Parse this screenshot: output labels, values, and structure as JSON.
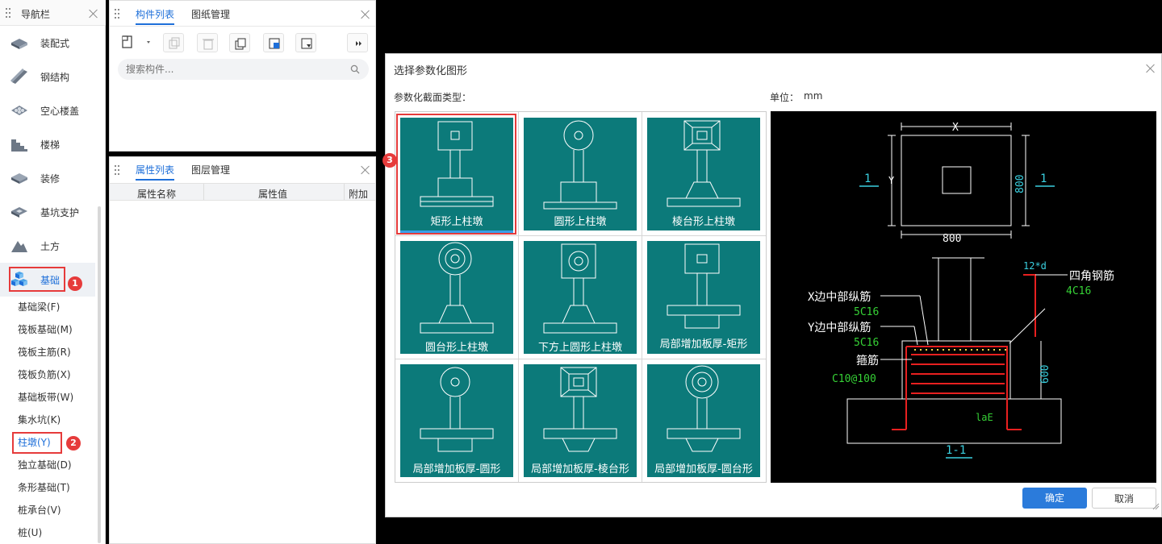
{
  "nav": {
    "title": "导航栏",
    "items": [
      {
        "label": "装配式",
        "icon": "prefab-icon"
      },
      {
        "label": "钢结构",
        "icon": "steel-beam-icon"
      },
      {
        "label": "空心楼盖",
        "icon": "hollow-slab-icon"
      },
      {
        "label": "楼梯",
        "icon": "stairs-icon"
      },
      {
        "label": "装修",
        "icon": "decoration-icon"
      },
      {
        "label": "基坑支护",
        "icon": "pit-support-icon"
      },
      {
        "label": "土方",
        "icon": "earthwork-icon"
      },
      {
        "label": "基础",
        "icon": "foundation-icon"
      }
    ],
    "sub_items": [
      "基础梁(F)",
      "筏板基础(M)",
      "筏板主筋(R)",
      "筏板负筋(X)",
      "基础板带(W)",
      "集水坑(K)",
      "柱墩(Y)",
      "独立基础(D)",
      "条形基础(T)",
      "桩承台(V)",
      "桩(U)"
    ],
    "badges": [
      "1",
      "2",
      "3"
    ]
  },
  "components": {
    "tabs": [
      "构件列表",
      "图纸管理"
    ],
    "search_placeholder": "搜索构件..."
  },
  "properties": {
    "tabs": [
      "属性列表",
      "图层管理"
    ],
    "columns": [
      "属性名称",
      "属性值",
      "附加"
    ]
  },
  "dialog": {
    "title": "选择参数化图形",
    "section_label": "参数化截面类型：",
    "unit_label": "单位：",
    "unit_value": "mm",
    "tiles": [
      "矩形上柱墩",
      "圆形上柱墩",
      "棱台形上柱墩",
      "圆台形上柱墩",
      "下方上圆形上柱墩",
      "局部增加板厚-矩形",
      "局部增加板厚-圆形",
      "局部增加板厚-棱台形",
      "局部增加板厚-圆台形"
    ],
    "confirm": "确定",
    "cancel": "取消"
  },
  "preview": {
    "x_label": "X",
    "y_label": "Y",
    "dim_bottom": "800",
    "dim_right": "800",
    "section_mark": "1",
    "top_right_dim": "12*d",
    "corner_bar": "四角钢筋",
    "corner_bar_spec": "4C16",
    "x_mid_bar": "X边中部纵筋",
    "x_mid_spec": "5C16",
    "y_mid_bar": "Y边中部纵筋",
    "y_mid_spec": "5C16",
    "stirrup": "箍筋",
    "stirrup_spec": "C10@100",
    "height_dim": "600",
    "anchor": "laE",
    "section_title": "1-1"
  },
  "colors": {
    "accent": "#1e6fd9",
    "tile": "#0c7a7a",
    "highlight": "#e63b3b",
    "cad_bg": "#000000"
  }
}
